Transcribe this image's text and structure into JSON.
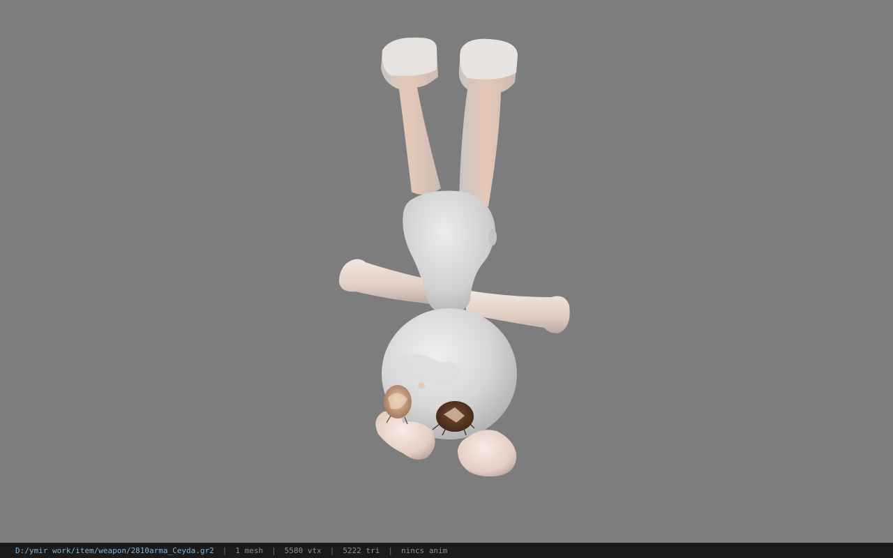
{
  "viewer": {
    "background_color": "#7d7d7d",
    "model_name": "bunny-doll-model"
  },
  "statusbar": {
    "file_path": "D:/ymir work/item/weapon/2810arma_Ceyda.gr2",
    "separator": "|",
    "mesh_count": "1 mesh",
    "vertex_count": "5580 vtx",
    "triangle_count": "5222 tri",
    "animation": "nincs anim"
  }
}
